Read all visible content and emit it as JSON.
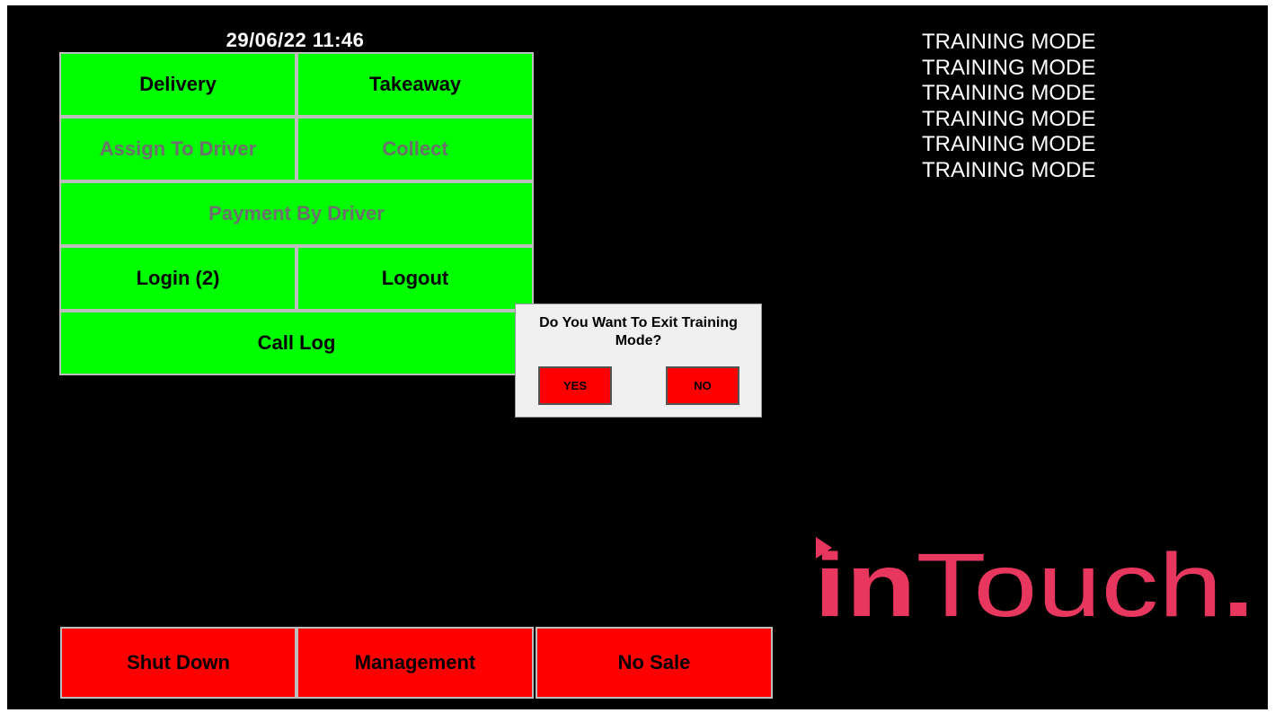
{
  "header": {
    "datetime": "29/06/22  11:46"
  },
  "menu": {
    "delivery": "Delivery",
    "takeaway": "Takeaway",
    "assign_to_driver": "Assign To Driver",
    "collect": "Collect",
    "payment_by_driver": "Payment By Driver",
    "login": "Login (2)",
    "logout": "Logout",
    "call_log": "Call Log"
  },
  "bottom_bar": {
    "shut_down": "Shut Down",
    "management": "Management",
    "no_sale": "No Sale"
  },
  "training_mode_lines": [
    "TRAINING MODE",
    "TRAINING MODE",
    "TRAINING MODE",
    "TRAINING MODE",
    "TRAINING MODE",
    "TRAINING MODE"
  ],
  "dialog": {
    "message": "Do You Want To Exit Training Mode?",
    "yes": "YES",
    "no": "NO"
  },
  "logo": {
    "bold_part": "in",
    "regular_part": "Touch",
    "dot": ".",
    "color": "#e8375f"
  },
  "colors": {
    "menu_green": "#00ff00",
    "action_red": "#ff0000",
    "disabled_text": "#6e6e6e"
  }
}
